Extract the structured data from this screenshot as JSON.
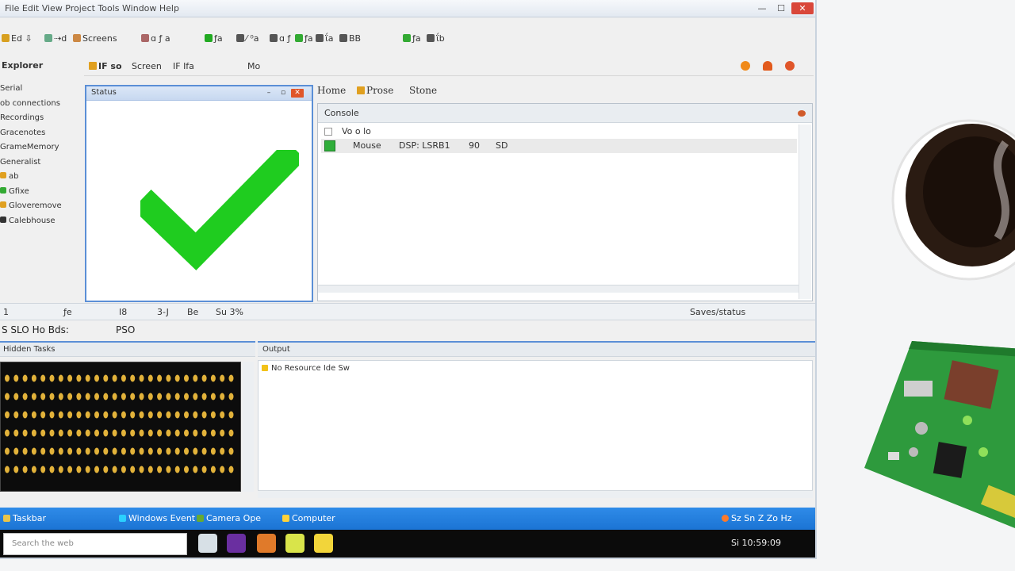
{
  "window": {
    "title": "File  Edit  View  Project  Tools  Window  Help",
    "controls": {
      "minimize": "—",
      "maximize": "☐",
      "close": "✕"
    }
  },
  "toolbar": {
    "items": [
      {
        "label": "Ed  ⇩",
        "icon": "folder-icon",
        "color": "#d8a020"
      },
      {
        "label": "⇢d",
        "icon": "arrow-icon",
        "color": "#6a8"
      },
      {
        "label": "Screens",
        "icon": "screen-icon",
        "color": "#c84"
      },
      {
        "label": "ɑ ƒ a",
        "icon": "script-icon",
        "color": "#a66"
      },
      {
        "label": "ƒa",
        "icon": "tool-icon",
        "color": "#2a2"
      },
      {
        "label": "⁄ ⁰a",
        "icon": "edit-icon",
        "color": "#555"
      },
      {
        "label": "ɑ ƒ",
        "icon": "build-icon",
        "color": "#555"
      },
      {
        "label": "ƒa",
        "icon": "run-icon",
        "color": "#3a3"
      },
      {
        "label": "ΐa",
        "icon": "debug-icon",
        "color": "#555"
      },
      {
        "label": "BB",
        "icon": "bookmark-icon",
        "color": "#555"
      },
      {
        "label": "ƒa",
        "icon": "settings-icon",
        "color": "#3a3"
      },
      {
        "label": "ΐb",
        "icon": "help-icon",
        "color": "#555"
      }
    ]
  },
  "nav": {
    "heading": "Explorer",
    "items": [
      {
        "label": "Serial",
        "marker": ""
      },
      {
        "label": "ob connections",
        "marker": ""
      },
      {
        "label": "Recordings",
        "marker": ""
      },
      {
        "label": "Gracenotes",
        "marker": ""
      },
      {
        "label": "GrameMemory",
        "marker": ""
      },
      {
        "label": "Generalist",
        "marker": ""
      },
      {
        "label": "ab",
        "marker": "#e0a020"
      },
      {
        "label": "Gfixe",
        "marker": "#3a3"
      },
      {
        "label": "Gloveremove",
        "marker": "#e0a020"
      },
      {
        "label": "Calebhouse",
        "marker": "#333"
      }
    ]
  },
  "panel_toolbar": {
    "left": [
      "IF  so",
      "Screen",
      "IF Ifa",
      "Mo"
    ],
    "right_icons": [
      "record-icon",
      "flame-icon",
      "close-icon"
    ]
  },
  "preview": {
    "title": "Status",
    "status": "success",
    "check_color": "#1fcc1f"
  },
  "right_tabs": [
    "Home",
    "Prose",
    "Stone"
  ],
  "list_panel": {
    "header": "Console",
    "rows": [
      {
        "col1": "Vo  o  lo",
        "col2": "",
        "col3": "",
        "col4": ""
      },
      {
        "col1": "Mouse",
        "col2": "DSP: LSRB1",
        "col3": "90",
        "col4": "SD"
      }
    ]
  },
  "status_strip": {
    "left": [
      "1",
      "ƒe",
      "I8",
      "3-J",
      "Be",
      "Su  3%"
    ],
    "right": "Saves/status"
  },
  "cmdline": {
    "label": "S  SLO  Ho  Bds:",
    "value": "PSO"
  },
  "bottom_left": {
    "header": "Hidden Tasks"
  },
  "bottom_right": {
    "header": "Output",
    "line": "No  Resource Ide Sw"
  },
  "task_strip": {
    "items": [
      {
        "label": "Taskbar",
        "color": "#e8c44a"
      },
      {
        "label": "Windows Event",
        "color": "#2ad0ff"
      },
      {
        "label": "Camera Ope",
        "color": "#6a3"
      },
      {
        "label": "Computer",
        "color": "#ffd23a"
      }
    ],
    "right": "Sz  Sn  Z  Zo  Hz"
  },
  "taskbar": {
    "search_placeholder": "Search the web",
    "apps": [
      {
        "name": "files-app-icon",
        "color": "#d7e0e6"
      },
      {
        "name": "media-app-icon",
        "color": "#6a2fa0"
      },
      {
        "name": "photos-app-icon",
        "color": "#e07a2a"
      },
      {
        "name": "notes-app-icon",
        "color": "#d9e44a"
      },
      {
        "name": "emoji-app-icon",
        "color": "#f2d53a"
      }
    ],
    "tray": "Si   10:59:09"
  },
  "scene": {
    "cup_label": "coffee-cup",
    "board_label": "circuit-board"
  }
}
